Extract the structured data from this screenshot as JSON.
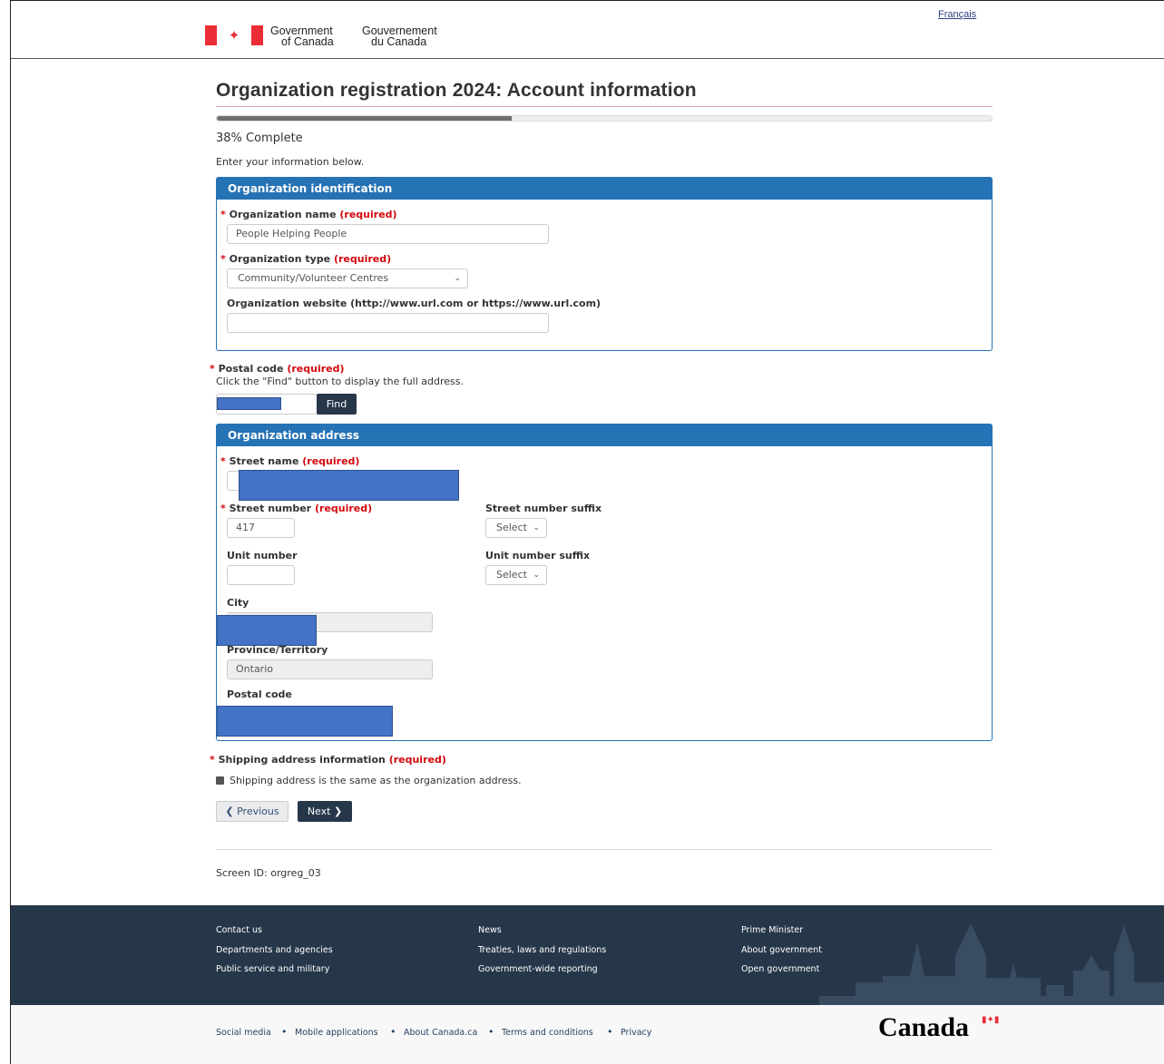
{
  "header": {
    "gov_en_line1": "Government",
    "gov_en_line2": "of Canada",
    "gov_fr_line1": "Gouvernement",
    "gov_fr_line2": "du Canada",
    "language_link": "Français",
    "flag_color": "#eb2d37"
  },
  "page": {
    "title": "Organization registration 2024: Account information",
    "progress_percent": 38,
    "progress_text": "38% Complete",
    "intro": "Enter your information below."
  },
  "identification": {
    "heading": "Organization identification",
    "name_label": "Organization name",
    "name_value": "People Helping People",
    "type_label": "Organization type",
    "type_value": "Community/Volunteer Centres",
    "website_label": "Organization website (http://www.url.com or https://www.url.com)",
    "website_value": ""
  },
  "required_text": "(required)",
  "required_star": "*",
  "postal": {
    "label": "Postal code",
    "hint": "Click the \"Find\" button to display the full address.",
    "find_button": "Find"
  },
  "address": {
    "heading": "Organization address",
    "street_name_label": "Street name",
    "street_number_label": "Street number",
    "street_number_value": "417",
    "street_suffix_label": "Street number suffix",
    "street_suffix_value": "Select",
    "unit_number_label": "Unit number",
    "unit_number_value": "",
    "unit_suffix_label": "Unit number suffix",
    "unit_suffix_value": "Select",
    "city_label": "City",
    "province_label": "Province/Territory",
    "province_value": "Ontario",
    "postal_label": "Postal code"
  },
  "shipping": {
    "label": "Shipping address information",
    "checkbox_label": "Shipping address is the same as the organization address.",
    "checked": true
  },
  "nav": {
    "previous": "Previous",
    "next": "Next"
  },
  "screen_id": "Screen ID: orgreg_03",
  "footer": {
    "col1": [
      "Contact us",
      "Departments and agencies",
      "Public service and military"
    ],
    "col2": [
      "News",
      "Treaties, laws and regulations",
      "Government-wide reporting"
    ],
    "col3": [
      "Prime Minister",
      "About government",
      "Open government"
    ],
    "bottom_links": [
      "Social media",
      "Mobile applications",
      "About Canada.ca",
      "Terms and conditions",
      "Privacy"
    ],
    "separator": "•",
    "wordmark": "Canada",
    "bg_color": "#26374a"
  },
  "colors": {
    "panel_blue": "#2572b4",
    "required_red": "#d3080c",
    "button_dark": "#26374a",
    "redaction_blue": "#4472c4"
  }
}
